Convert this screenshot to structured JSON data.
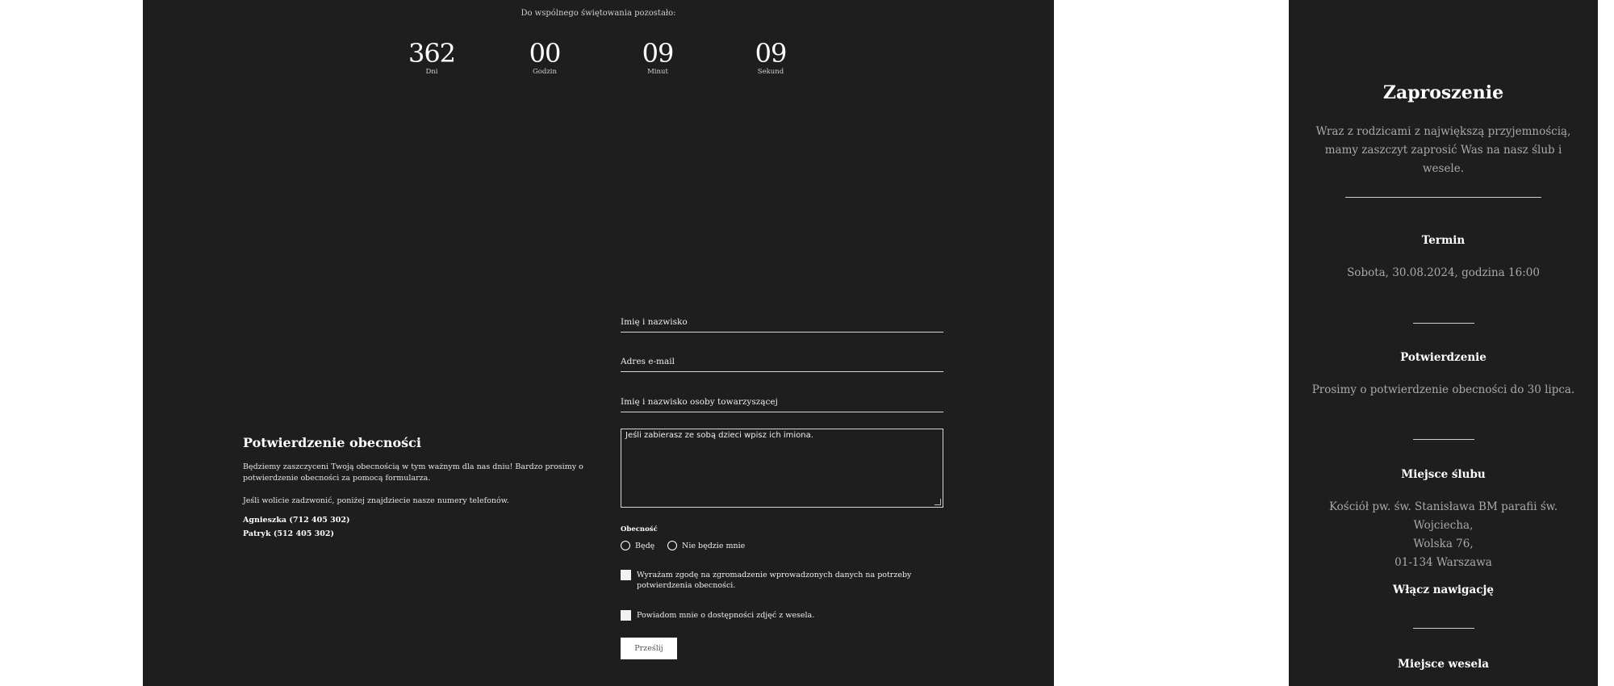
{
  "countdown": {
    "intro": "Do wspólnego świętowania pozostało:",
    "days": {
      "value": "362",
      "label": "Dni"
    },
    "hours": {
      "value": "00",
      "label": "Godzin"
    },
    "minutes": {
      "value": "09",
      "label": "Minut"
    },
    "seconds": {
      "value": "09",
      "label": "Sekund"
    }
  },
  "rsvp": {
    "title": "Potwierdzenie obecności",
    "description": "Będziemy zaszczyceni Twoją obecnością w tym ważnym dla nas dniu! Bardzo prosimy o potwierdzenie obecności za pomocą formularza.",
    "call_note": "Jeśli wolicie zadzwonić, poniżej znajdziecie nasze numery telefonów.",
    "contact_1": "Agnieszka (712 405 302)",
    "contact_2": "Patryk (512 405 302)"
  },
  "form": {
    "name_placeholder": "Imię i nazwisko",
    "email_placeholder": "Adres e-mail",
    "companion_placeholder": "Imię i nazwisko osoby towarzyszącej",
    "children_placeholder": "Jeśli zabierasz ze sobą dzieci wpisz ich imiona.",
    "attendance_label": "Obecność",
    "option_yes": "Będę",
    "option_no": "Nie będzie mnie",
    "consent_label": "Wyrażam zgodę na zgromadzenie wprowadzonych danych na potrzeby potwierdzenia obecności.",
    "photos_label": "Powiadom mnie o dostępności zdjęć z wesela.",
    "submit_label": "Prześlij"
  },
  "sidebar": {
    "title": "Zaproszenie",
    "intro": "Wraz z rodzicami z największą przyjemnością, mamy zaszczyt zaprosić Was na nasz ślub i wesele.",
    "date_title": "Termin",
    "date_text": "Sobota, 30.08.2024, godzina 16:00",
    "confirm_title": "Potwierdzenie",
    "confirm_text": "Prosimy o potwierdzenie obecności do 30 lipca.",
    "ceremony_title": "Miejsce ślubu",
    "ceremony_line1": "Kościół pw. św. Stanisława BM parafii św. Wojciecha,",
    "ceremony_line2": "Wolska 76,",
    "ceremony_line3": "01-134 Warszawa",
    "navigation_link": "Włącz nawigację",
    "reception_title": "Miejsce wesela"
  }
}
